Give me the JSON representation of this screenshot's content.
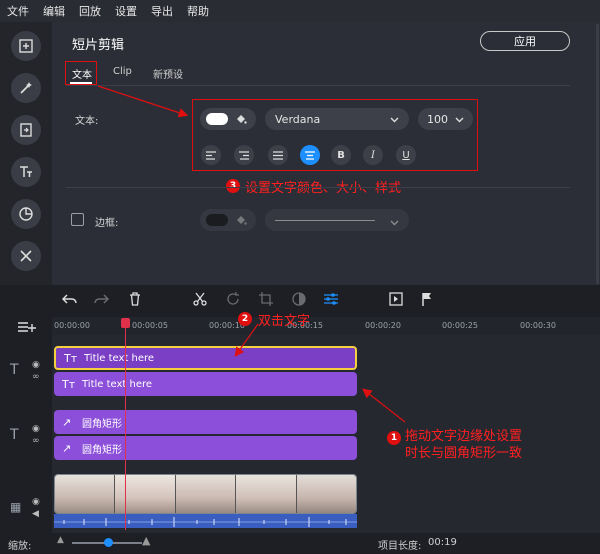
{
  "menu": [
    "文件",
    "编辑",
    "回放",
    "设置",
    "导出",
    "帮助"
  ],
  "sidebar_icons": [
    "add-media-icon",
    "magic-wand-icon",
    "trim-icon",
    "text-icon",
    "sticker-icon",
    "tools-icon"
  ],
  "panel": {
    "title": "短片剪辑",
    "apply_label": "应用",
    "tabs": [
      "文本",
      "Clip",
      "新预设"
    ],
    "text_label": "文本:",
    "font": "Verdana",
    "font_size": "100",
    "border_label": "边框:",
    "border_checked": false
  },
  "annotations": {
    "a3_num": "3",
    "a3_text": "设置文字颜色、大小、样式",
    "a2_num": "2",
    "a2_text": "双击文字",
    "a1_num": "1",
    "a1_text_line1": "拖动文字边缘处设置",
    "a1_text_line2": "时长与圆角矩形一致"
  },
  "ruler_ticks": [
    "00:00:00",
    "00:00:05",
    "00:00:10",
    "00:00:15",
    "00:00:20",
    "00:00:25",
    "00:00:30"
  ],
  "clips": {
    "title1": "Title text here",
    "title2": "Title text here",
    "shape1": "圆角矩形",
    "shape2": "圆角矩形"
  },
  "status": {
    "zoom_label": "缩放:",
    "project_length_label": "项目长度:",
    "project_length": "00:19"
  },
  "colors": {
    "accent": "#1e8fff",
    "clip_purple": "#8b4fd9",
    "annotation_red": "#e01010"
  }
}
